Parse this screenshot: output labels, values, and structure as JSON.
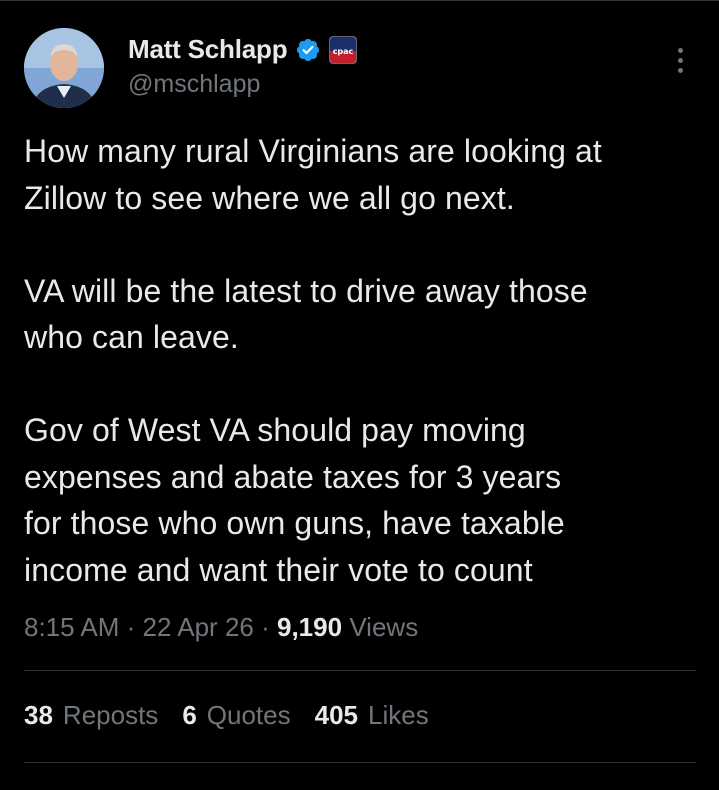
{
  "author": {
    "display_name": "Matt Schlapp",
    "handle": "@mschlapp",
    "org_badge_text": "cpac"
  },
  "tweet": {
    "text": "How many rural Virginians are looking at\nZillow to see where we all go next.\n\nVA will be the latest to drive away those\nwho can leave.\n\nGov of West VA should pay moving\nexpenses and abate taxes for 3 years\nfor those who own guns, have taxable\nincome and want their vote to count"
  },
  "meta": {
    "time": "8:15 AM",
    "sep1": "·",
    "date": "22 Apr 26",
    "sep2": "·",
    "views_count": "9,190",
    "views_label": "Views"
  },
  "stats": {
    "reposts_count": "38",
    "reposts_label": "Reposts",
    "quotes_count": "6",
    "quotes_label": "Quotes",
    "likes_count": "405",
    "likes_label": "Likes"
  },
  "colors": {
    "background": "#000000",
    "text": "#e7e9ea",
    "secondary": "#71767b",
    "verified": "#1d9bf0",
    "divider": "#2f3336"
  },
  "icons": [
    "verified-badge-icon",
    "organization-badge-icon",
    "more-options-icon"
  ]
}
